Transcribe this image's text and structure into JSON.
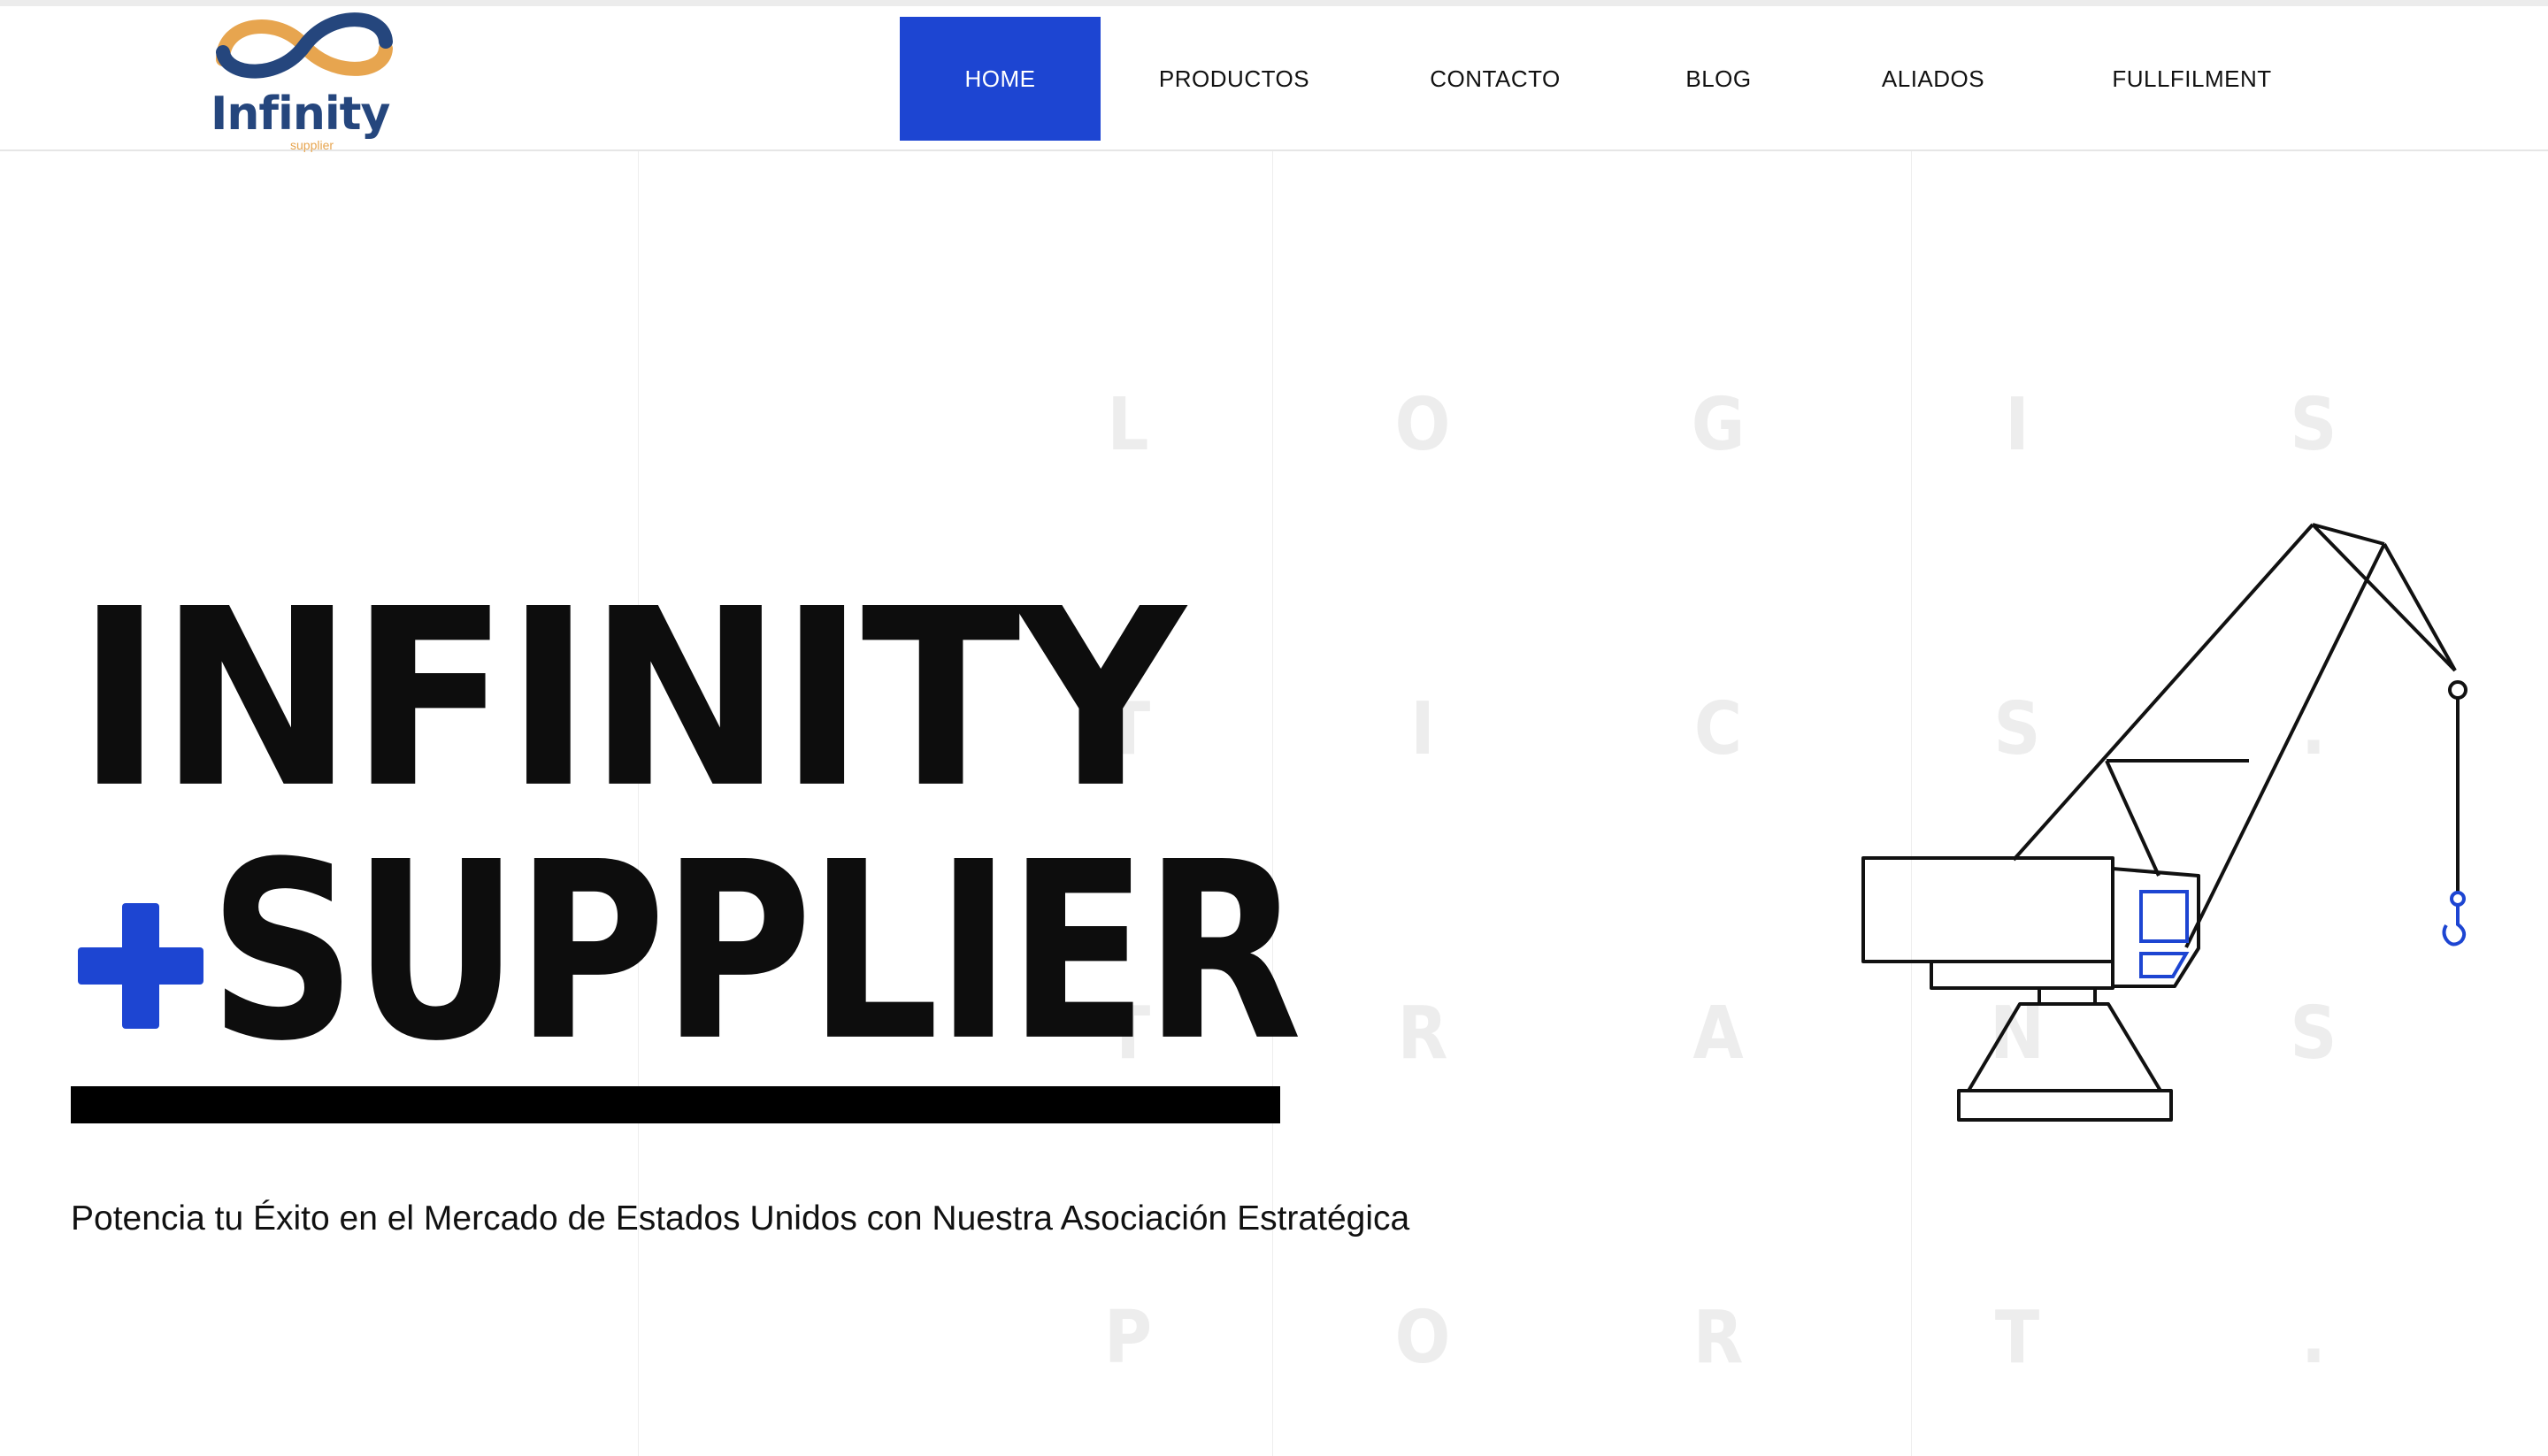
{
  "brand": {
    "name": "Infinity",
    "sub": "supplier",
    "colors": {
      "navy": "#25467d",
      "orange": "#e7a54f"
    }
  },
  "nav": {
    "items": [
      {
        "label": "HOME",
        "active": true
      },
      {
        "label": "PRODUCTOS",
        "active": false
      },
      {
        "label": "CONTACTO",
        "active": false
      },
      {
        "label": "BLOG",
        "active": false
      },
      {
        "label": "ALIADOS",
        "active": false
      },
      {
        "label": "FULLFILMENT",
        "active": false
      }
    ],
    "active_color": "#1d45d2"
  },
  "hero": {
    "line1": "INFINITY",
    "line2": "SUPPLIER",
    "plus_icon": "plus-icon",
    "subtitle": "Potencia tu Éxito en el Mercado de Estados Unidos con Nuestra Asociación Estratégica",
    "accent": "#1d45d2"
  },
  "watermark": {
    "rows": [
      [
        "L",
        "O",
        "G",
        "I",
        "S"
      ],
      [
        "T",
        "I",
        "C",
        "S",
        "."
      ],
      [
        "T",
        "R",
        "A",
        "N",
        "S"
      ],
      [
        "P",
        "O",
        "R",
        "T",
        "."
      ]
    ]
  },
  "illustration": {
    "icon": "crane-icon"
  }
}
